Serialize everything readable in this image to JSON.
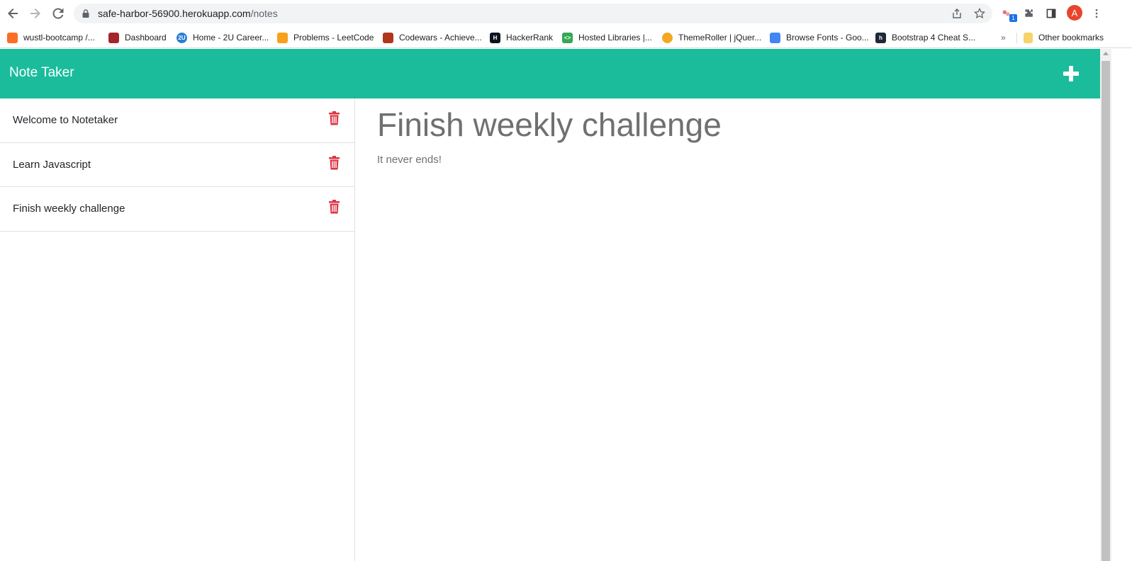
{
  "browser": {
    "url_host": "safe-harbor-56900.herokuapp.com",
    "url_path": "/notes",
    "extension_badge": "1",
    "avatar_letter": "A",
    "bookmarks": [
      {
        "label": "wustl-bootcamp /...",
        "icon": "gitlab-icon",
        "color": "#fc6d26"
      },
      {
        "label": "Dashboard",
        "icon": "canvas-icon",
        "color": "#a4262c"
      },
      {
        "label": "Home - 2U Career...",
        "icon": "2u-icon",
        "color": "#2d7dd2"
      },
      {
        "label": "Problems - LeetCode",
        "icon": "leetcode-icon",
        "color": "#f89f1b"
      },
      {
        "label": "Codewars - Achieve...",
        "icon": "codewars-icon",
        "color": "#b1361e"
      },
      {
        "label": "HackerRank",
        "icon": "hackerrank-icon",
        "color": "#0e141e"
      },
      {
        "label": "Hosted Libraries  |...",
        "icon": "code-icon",
        "color": "#34a853"
      },
      {
        "label": "ThemeRoller | jQuer...",
        "icon": "themeroller-icon",
        "color": "#f5a623"
      },
      {
        "label": "Browse Fonts - Goo...",
        "icon": "google-fonts-icon",
        "color": "#4285f4"
      },
      {
        "label": "Bootstrap 4 Cheat S...",
        "icon": "hackerthemes-icon",
        "color": "#1f2937"
      }
    ],
    "bookmarks_more": "»",
    "other_bookmarks": "Other bookmarks"
  },
  "app": {
    "title": "Note Taker",
    "accent_color": "#1abc9c",
    "delete_color": "#dc3545",
    "notes": [
      {
        "title": "Welcome to Notetaker"
      },
      {
        "title": "Learn Javascript"
      },
      {
        "title": "Finish weekly challenge"
      }
    ],
    "active_note": {
      "title": "Finish weekly challenge",
      "text": "It never ends!"
    }
  }
}
